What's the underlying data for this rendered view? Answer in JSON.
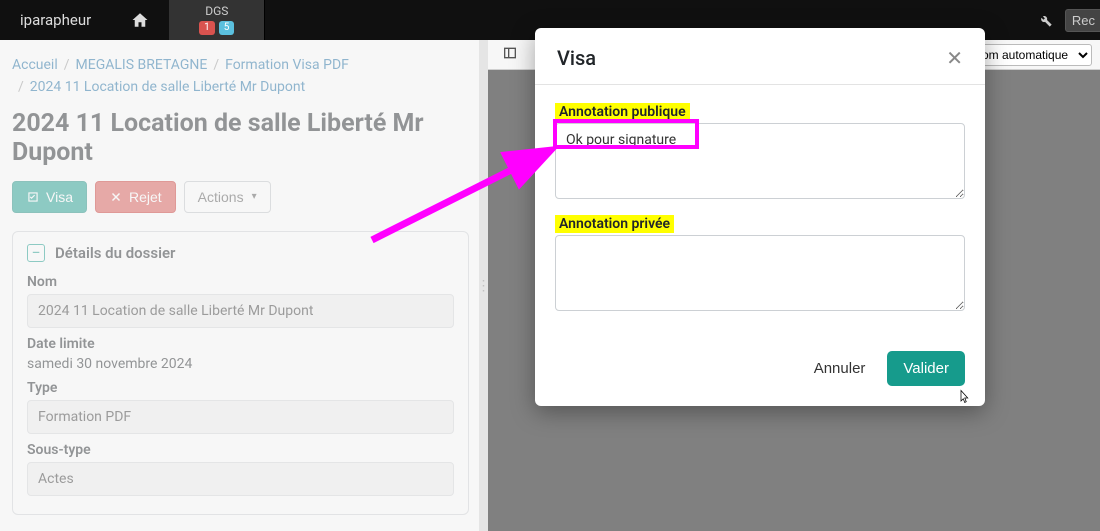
{
  "navbar": {
    "brand": "iparapheur",
    "tab_label": "DGS",
    "badge_red": "1",
    "badge_blue": "5",
    "truncated_btn": "Rec"
  },
  "breadcrumb": {
    "items": [
      "Accueil",
      "MEGALIS BRETAGNE",
      "Formation Visa PDF",
      "2024 11 Location de salle Liberté Mr Dupont"
    ]
  },
  "page_title": "2024 11 Location de salle Liberté Mr Dupont",
  "actions": {
    "visa": "Visa",
    "reject": "Rejet",
    "menu": "Actions"
  },
  "details": {
    "card_title": "Détails du dossier",
    "name_label": "Nom",
    "name_value": "2024 11 Location de salle Liberté Mr Dupont",
    "deadline_label": "Date limite",
    "deadline_value": "samedi 30 novembre 2024",
    "type_label": "Type",
    "type_value": "Formation PDF",
    "subtype_label": "Sous-type",
    "subtype_value": "Actes"
  },
  "pdf_toolbar": {
    "zoom_selected": "om automatique"
  },
  "modal": {
    "title": "Visa",
    "pub_label": "Annotation publique",
    "pub_value": "Ok pour signature",
    "priv_label": "Annotation privée",
    "priv_value": "",
    "cancel": "Annuler",
    "validate": "Valider"
  }
}
